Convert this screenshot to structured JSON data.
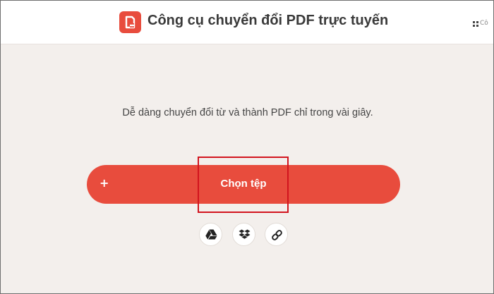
{
  "header": {
    "title": "Công cụ chuyển đổi PDF trực tuyến",
    "truncated_right_label": "Cô"
  },
  "main": {
    "subtitle": "Dễ dàng chuyển đổi từ và thành PDF chỉ trong vài giây.",
    "choose_button": {
      "plus": "+",
      "label": "Chọn tệp"
    },
    "sources": [
      {
        "icon": "google-drive-icon"
      },
      {
        "icon": "dropbox-icon"
      },
      {
        "icon": "link-icon"
      }
    ]
  },
  "colors": {
    "accent": "#e84c3d",
    "highlight_box": "#d2141e",
    "background": "#f3efec"
  }
}
